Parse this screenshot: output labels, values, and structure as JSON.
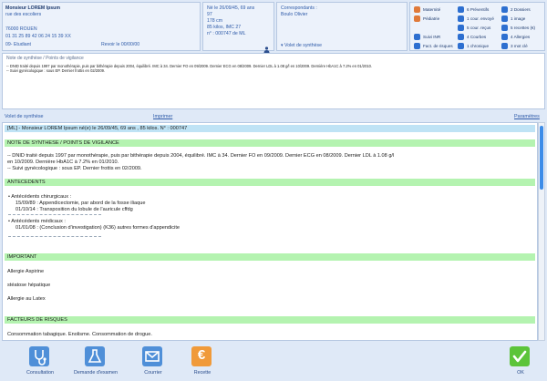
{
  "patient": {
    "name": "Monsieur LOREM Ipsum",
    "street": "rue des escoliers",
    "city": "76000 ROUEN",
    "phones": "01 31 25 89 42    06 24 15 39 XX",
    "status": "09- Etudiant",
    "revoir": "Revoir le 00/00/00",
    "birth": "Né le 26/09/45, 69 ans",
    "line2": "97",
    "height": "178 cm",
    "weight": "85 kilos, IMC 27",
    "number": "n° : 000747 de ML"
  },
  "correspondants": {
    "title": "Correspondants :",
    "name": "Boulo Olivier",
    "synthese_link": "▾ Volet de synthèse"
  },
  "quicklinks": {
    "col1": [
      "Maternité",
      "Pédiatrie",
      "",
      "Suivi INR",
      "Fact. de risques"
    ],
    "col2": [
      "6 Préventifs",
      "1 cour. envoyé",
      "5 cour. reçus",
      "4 Courbes",
      "1 chronique"
    ],
    "col3": [
      "2 Dossiers",
      "1 image",
      "5 recettes (€)",
      "4 Allergies",
      "3 mot clé"
    ],
    "colors": {
      "col1": "#e07a3a",
      "col2": "#2d6fd0",
      "col3": "#2d6fd0"
    }
  },
  "note": {
    "title": "Note de synthèse / Points de vigilance",
    "line1": "-- DNID traité depuis 1997 par monothérapie, puis par bithérapie depuis 2004, équilibré. IMC à 34. Dernier FO en 09/2009. Dernier ECG en 08/2009. Dernier LDL à 1.08 g/l en 10/2009. Dernière HbA1C à 7.2% en 01/2010.",
    "line2": "-- Suivi gynécologique : sous EP. Dernier frottis en 02/2009."
  },
  "links": {
    "volet": "Volet de synthèse",
    "imprimer": "Imprimer",
    "parametres": "Paramètres"
  },
  "document": {
    "header": "[ML] - Monsieur LOREM Ipsum   né(e) le 26/09/45, 69 ans , 85 kilos.  N° : 000747",
    "section_note": "NOTE DE SYNTHESE / POINTS DE VIGILANCE",
    "note_line1": "-- DNID  traité  depuis  1997  par  monothérapie,  puis  par  bithérapie  depuis  2004,  équilibré.  IMC  à  34.  Dernier  FO  en  09/2009.  Dernier  ECG  en  08/2009.  Dernier  LDL  à  1.08  g/l",
    "note_line2": "    en  10/2009.  Dernière  HbA1C  à  7.2%  en  01/2010.",
    "note_line3": "-- Suivi  gynécologique  :  sous  EP.  Dernier  frottis  en  02/2009.",
    "section_antecedents": "ANTECEDENTS",
    "chir_title": "• Antécédents chirurgicaux :",
    "chir_items": [
      "15/09/89 : Appendicectomie, par abord de la fosse iliaque",
      "01/10/14 : Transposition du lobule de l'auricule cffdg"
    ],
    "med_title": "• Antécédents médicaux :",
    "med_items": [
      "01/01/08 : (Conclusion d'investigation) (K36) autres formes d'appendicite"
    ],
    "section_important": "IMPORTANT",
    "important_items": [
      "Allergie Aspirine",
      "stéatose hépatique",
      "Allergie au Latex"
    ],
    "section_risques": "FACTEURS DE RISQUES",
    "risques_line": "Consommation tabagique. Enolisme. Consommation de drogue."
  },
  "toolbar": {
    "consultation": "Consultation",
    "examen": "Demande d'examen",
    "courrier": "Courrier",
    "recette": "Recette",
    "ok": "OK",
    "recette_glyph": "€"
  }
}
